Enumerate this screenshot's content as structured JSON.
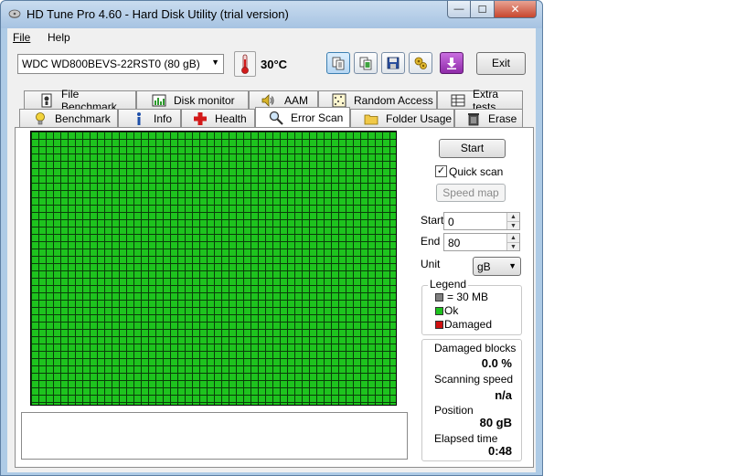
{
  "window": {
    "title": "HD Tune Pro 4.60 - Hard Disk Utility (trial version)",
    "minimize_glyph": "—",
    "maximize_glyph": "☐",
    "close_glyph": "✕"
  },
  "menu": {
    "file": "File",
    "help": "Help"
  },
  "toolbar": {
    "drive": "WDC WD800BEVS-22RST0 (80 gB)",
    "temperature": "30°C",
    "exit_label": "Exit",
    "icons": [
      "copy-info-icon",
      "copy-screenshot-icon",
      "save-icon",
      "options-icon",
      "download-icon"
    ]
  },
  "tabs": {
    "row1": [
      "File Benchmark",
      "Disk monitor",
      "AAM",
      "Random Access",
      "Extra tests"
    ],
    "row2": [
      "Benchmark",
      "Info",
      "Health",
      "Error Scan",
      "Folder Usage",
      "Erase"
    ],
    "active": "Error Scan"
  },
  "error_scan": {
    "start_button": "Start",
    "quick_scan_label": "Quick scan",
    "quick_scan_checked": true,
    "speed_map_button": "Speed map",
    "start_label": "Start",
    "start_value": "0",
    "end_label": "End",
    "end_value": "80",
    "unit_label": "Unit",
    "unit_value": "gB",
    "legend": {
      "title": "Legend",
      "block_size": "= 30 MB",
      "ok": "Ok",
      "damaged": "Damaged"
    },
    "stats": {
      "damaged_blocks_label": "Damaged blocks",
      "damaged_blocks_value": "0.0 %",
      "scanning_speed_label": "Scanning speed",
      "scanning_speed_value": "n/a",
      "position_label": "Position",
      "position_value": "80 gB",
      "elapsed_label": "Elapsed time",
      "elapsed_value": "0:48"
    }
  },
  "colors": {
    "block_ok": "#1ec31e",
    "block_damaged": "#d01010",
    "block_gray": "#808080"
  }
}
